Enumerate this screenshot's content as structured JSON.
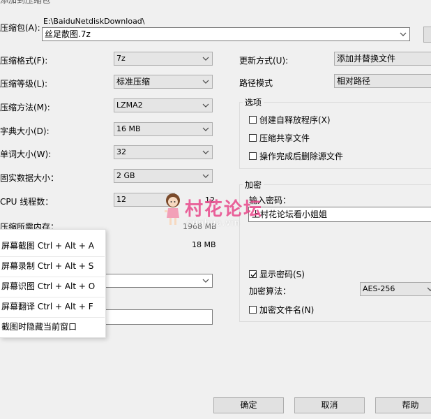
{
  "window": {
    "title_fragment": "添加到压缩包"
  },
  "archive": {
    "label": "压缩包(A):",
    "path": "E:\\BaiduNetdiskDownload\\",
    "filename": "丝足散图.7z"
  },
  "left": {
    "format": {
      "label": "压缩格式(F):",
      "value": "7z"
    },
    "level": {
      "label": "压缩等级(L):",
      "value": "标准压缩"
    },
    "method": {
      "label": "压缩方法(M):",
      "value": "LZMA2"
    },
    "dict": {
      "label": "字典大小(D):",
      "value": "16 MB"
    },
    "word": {
      "label": "单词大小(W):",
      "value": "32"
    },
    "solid": {
      "label": "固实数据大小：",
      "value": "2 GB"
    },
    "threads": {
      "label": "CPU 线程数：",
      "value": "12",
      "max": "12"
    },
    "memory": {
      "label": "压缩所需内存：",
      "value": "1968 MB"
    },
    "decomp_memory": {
      "value": "18 MB"
    }
  },
  "right": {
    "update": {
      "label": "更新方式(U):",
      "value": "添加并替换文件"
    },
    "pathmode": {
      "label": "路径模式",
      "value": "相对路径"
    },
    "options": {
      "title": "选项",
      "items": [
        {
          "label": "创建自释放程序(X)",
          "checked": false
        },
        {
          "label": "压缩共享文件",
          "checked": false
        },
        {
          "label": "操作完成后删除源文件",
          "checked": false
        }
      ]
    },
    "encryption": {
      "title": "加密",
      "password_label": "输入密码：",
      "password_value": "上村花论坛看小姐姐",
      "show_password": {
        "label": "显示密码(S)",
        "checked": true
      },
      "method_label": "加密算法：",
      "method_value": "AES-256",
      "encrypt_names": {
        "label": "加密文件名(N)",
        "checked": false
      }
    }
  },
  "context_menu": {
    "items": [
      "屏幕截图 Ctrl + Alt + A",
      "屏幕录制 Ctrl + Alt + S",
      "屏幕识图 Ctrl + Alt + O",
      "屏幕翻译 Ctrl + Alt + F",
      "截图时隐藏当前窗口"
    ]
  },
  "watermark": {
    "text": "村花论坛",
    "sub": "cunhua.vin",
    "color": "#e8488a"
  },
  "buttons": {
    "ok": "确定",
    "cancel": "取消",
    "help": "帮助"
  }
}
